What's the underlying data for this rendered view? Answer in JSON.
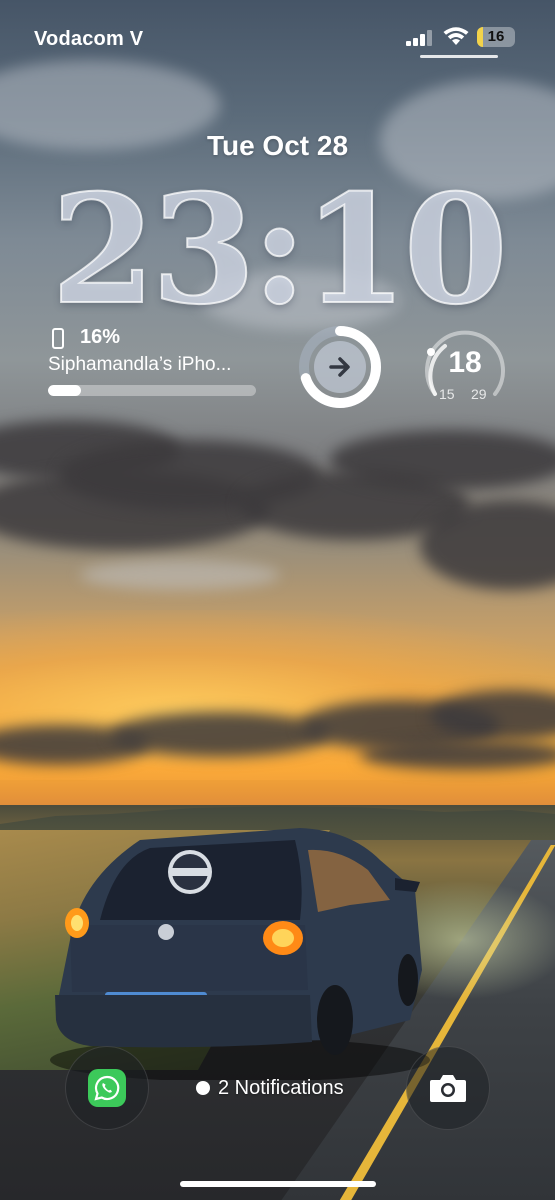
{
  "status_bar": {
    "carrier": "Vodacom V",
    "battery_level": "16",
    "signal_icon": "cellular-signal-icon",
    "wifi_icon": "wifi-icon"
  },
  "lock_screen": {
    "date": "Tue Oct 28",
    "time": "23:10"
  },
  "widgets": {
    "battery": {
      "icon": "iphone-icon",
      "percent": "16%",
      "device_name": "Siphamandla’s iPho...",
      "level": 0.16
    },
    "shortcut": {
      "icon": "arrow-right-icon",
      "progress": 0.7
    },
    "weather": {
      "current": "18",
      "low": "15",
      "high": "29"
    }
  },
  "bottom_bar": {
    "left_button_icon": "whatsapp-icon",
    "notifications_label": "2 Notifications",
    "right_button_icon": "camera-icon"
  },
  "colors": {
    "battery_low": "#f3d34a",
    "whatsapp_green": "#3cc95a",
    "road_line": "#e6b63a"
  }
}
